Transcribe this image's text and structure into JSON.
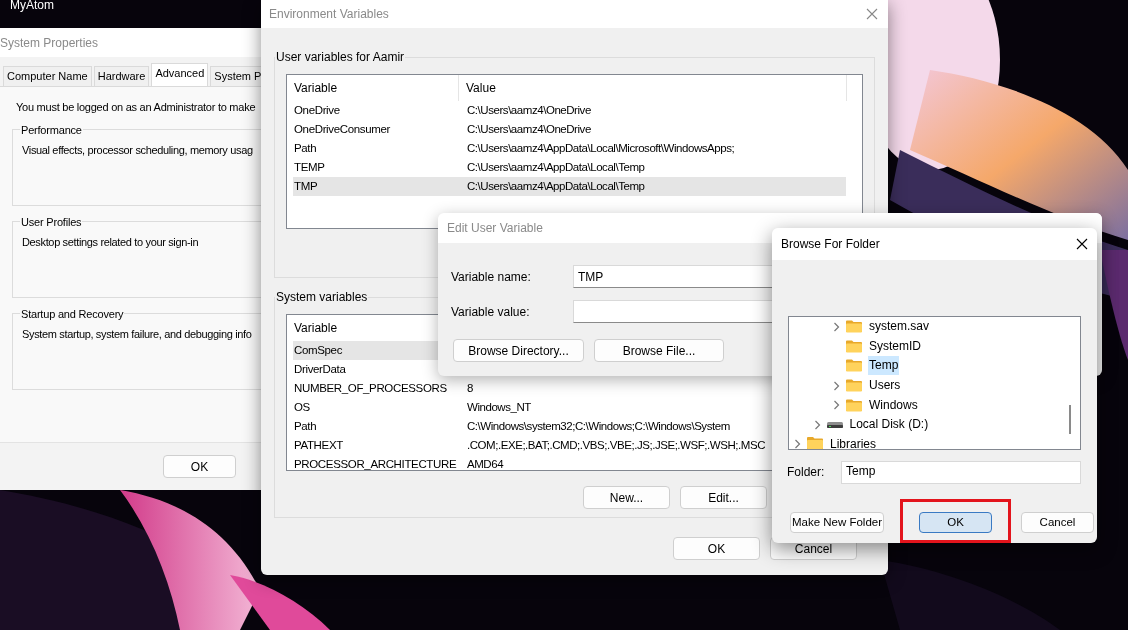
{
  "desktop": {
    "icon_label": "MyAtom"
  },
  "system_properties": {
    "title": "System Properties",
    "active": false,
    "tabs": [
      {
        "label": "Computer Name",
        "selected": false
      },
      {
        "label": "Hardware",
        "selected": false
      },
      {
        "label": "Advanced",
        "selected": true
      },
      {
        "label": "System P",
        "selected": false
      }
    ],
    "notice": "You must be logged on as an Administrator to make",
    "groups": [
      {
        "title": "Performance",
        "description": "Visual effects, processor scheduling, memory usag"
      },
      {
        "title": "User Profiles",
        "description": "Desktop settings related to your sign-in"
      },
      {
        "title": "Startup and Recovery",
        "description": "System startup, system failure, and debugging info"
      }
    ],
    "buttons": [
      "OK"
    ]
  },
  "environment_variables": {
    "title": "Environment Variables",
    "active": false,
    "user_variables": {
      "title": "User variables for Aamir",
      "columns": [
        "Variable",
        "Value"
      ],
      "rows": [
        {
          "name": "OneDrive",
          "value": "C:\\Users\\aamz4\\OneDrive",
          "selected": false
        },
        {
          "name": "OneDriveConsumer",
          "value": "C:\\Users\\aamz4\\OneDrive",
          "selected": false
        },
        {
          "name": "Path",
          "value": "C:\\Users\\aamz4\\AppData\\Local\\Microsoft\\WindowsApps;",
          "selected": false
        },
        {
          "name": "TEMP",
          "value": "C:\\Users\\aamz4\\AppData\\Local\\Temp",
          "selected": false
        },
        {
          "name": "TMP",
          "value": "C:\\Users\\aamz4\\AppData\\Local\\Temp",
          "selected": true
        }
      ]
    },
    "system_variables": {
      "title": "System variables",
      "columns": [
        "Variable"
      ],
      "rows": [
        {
          "name": "ComSpec",
          "selected": true
        },
        {
          "name": "DriverData",
          "selected": false
        },
        {
          "name": "NUMBER_OF_PROCESSORS",
          "value": "8",
          "selected": false
        },
        {
          "name": "OS",
          "value": "Windows_NT",
          "selected": false
        },
        {
          "name": "Path",
          "value": "C:\\Windows\\system32;C:\\Windows;C:\\Windows\\System",
          "selected": false
        },
        {
          "name": "PATHEXT",
          "value": ".COM;.EXE;.BAT;.CMD;.VBS;.VBE;.JS;.JSE;.WSF;.WSH;.MSC",
          "selected": false
        },
        {
          "name": "PROCESSOR_ARCHITECTURE",
          "value": "AMD64",
          "selected": false
        }
      ]
    },
    "system_buttons": [
      "New...",
      "Edit..."
    ],
    "buttons": [
      "OK",
      "Cancel"
    ]
  },
  "edit_user_variable": {
    "title": "Edit User Variable",
    "active": false,
    "fields": [
      {
        "label": "Variable name:",
        "value": "TMP"
      },
      {
        "label": "Variable value:"
      }
    ],
    "buttons": [
      "Browse Directory...",
      "Browse File..."
    ]
  },
  "browse_for_folder": {
    "title": "Browse For Folder",
    "active": true,
    "tree": [
      {
        "children": [
          {
            "children": [
              {
                "label": "system.sav",
                "kind": "folder",
                "expandable": true,
                "selected": false
              },
              {
                "label": "SystemID",
                "kind": "folder",
                "expandable": false,
                "selected": false
              },
              {
                "label": "Temp",
                "kind": "folder",
                "expandable": false,
                "selected": true
              },
              {
                "label": "Users",
                "kind": "folder",
                "expandable": true,
                "selected": false
              },
              {
                "label": "Windows",
                "kind": "folder",
                "expandable": true,
                "selected": false
              }
            ]
          },
          {
            "label": "Local Disk (D:)",
            "kind": "drive",
            "expandable": true,
            "selected": false
          }
        ]
      },
      {
        "label": "Libraries",
        "kind": "library",
        "expandable": true,
        "selected": false
      }
    ],
    "folder": {
      "label": "Folder:",
      "value": "Temp"
    },
    "buttons": [
      {
        "label": "Make New Folder",
        "default": false,
        "annotated": false
      },
      {
        "label": "OK",
        "default": true,
        "annotated": true
      },
      {
        "label": "Cancel",
        "default": false,
        "annotated": false
      }
    ]
  }
}
